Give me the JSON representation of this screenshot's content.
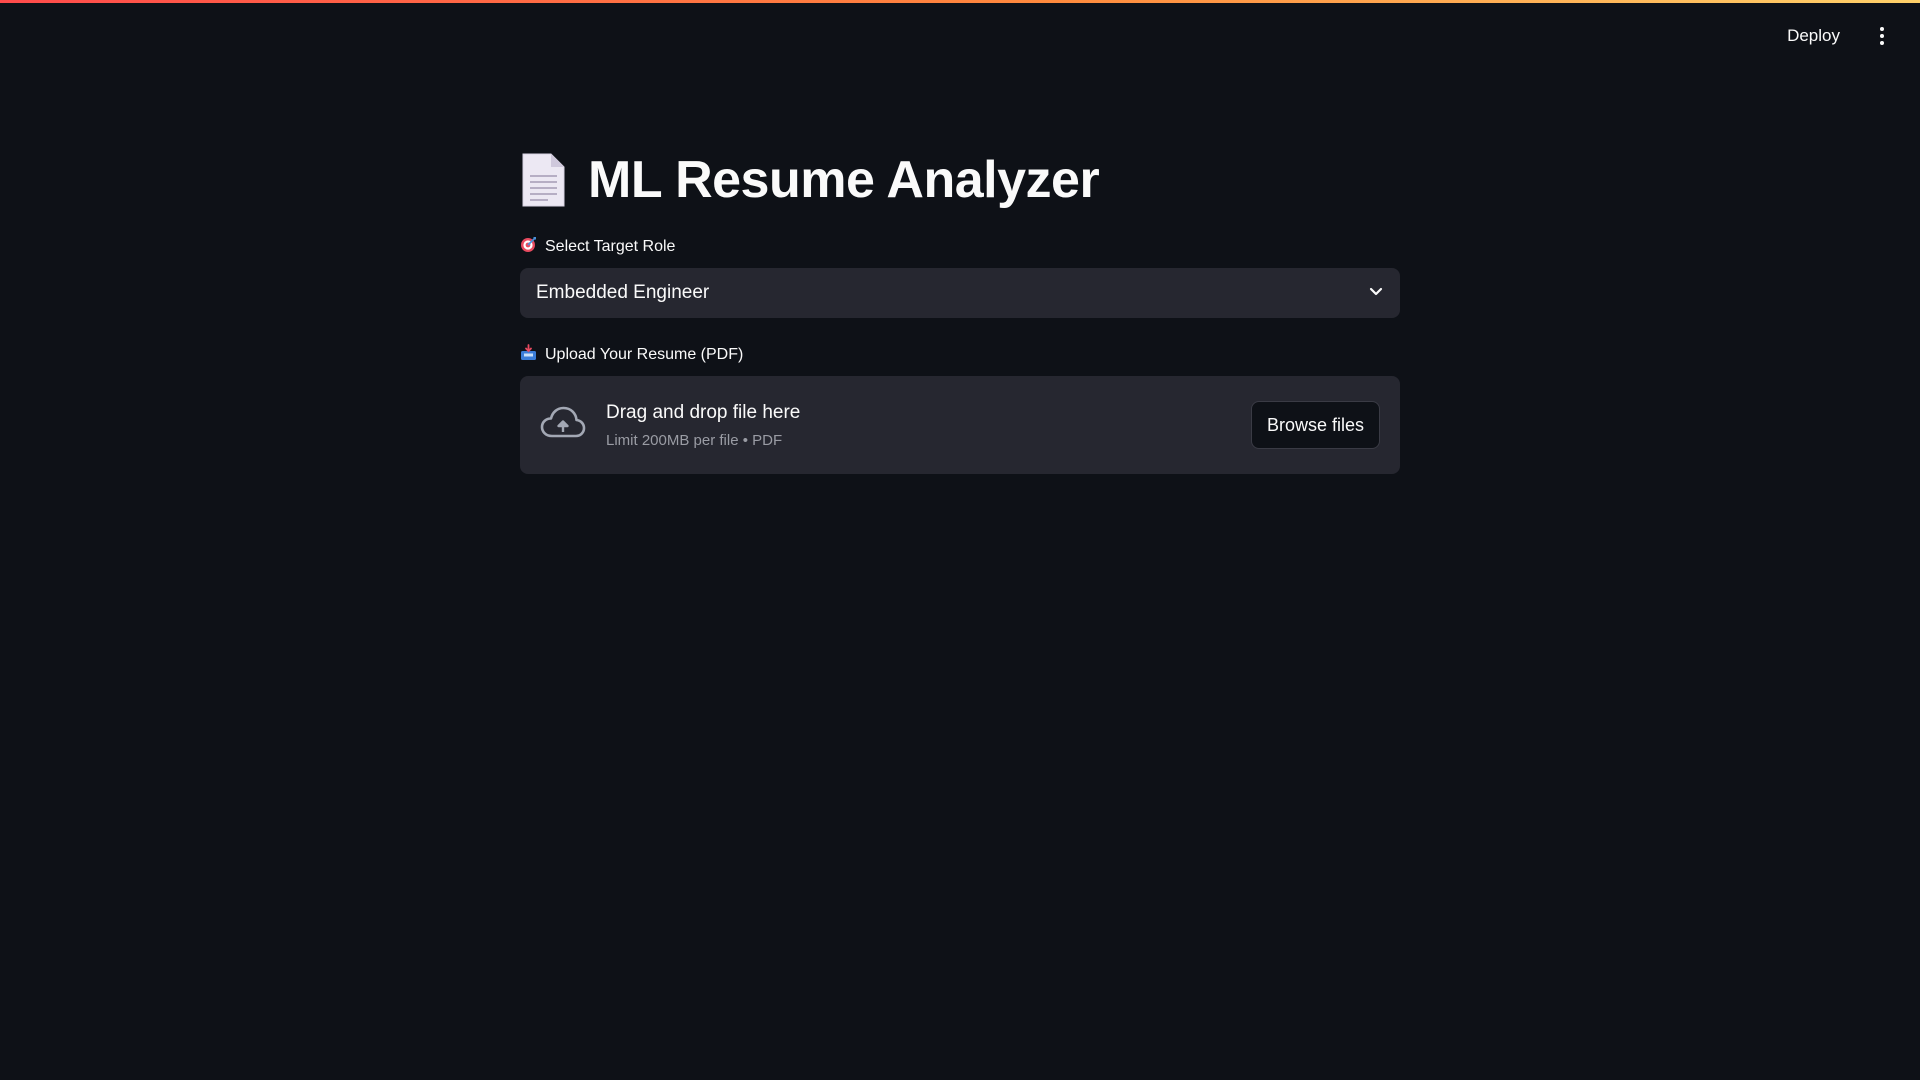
{
  "header": {
    "deploy_label": "Deploy",
    "menu_icon": "vertical-dots-icon"
  },
  "main": {
    "title_icon": "page-document-icon",
    "title": "ML Resume Analyzer",
    "role_select": {
      "icon": "target-dart-icon",
      "label": "Select Target Role",
      "value": "Embedded Engineer",
      "chevron_icon": "chevron-down-icon"
    },
    "uploader": {
      "icon": "inbox-tray-icon",
      "label": "Upload Your Resume (PDF)",
      "cloud_icon": "cloud-upload-icon",
      "drag_text": "Drag and drop file here",
      "limit_text": "Limit 200MB per file • PDF",
      "browse_label": "Browse files"
    }
  },
  "colors": {
    "background": "#0e1117",
    "input_background": "#262730",
    "accent_gradient_start": "#ff4b4b",
    "accent_gradient_end": "#ffd16a"
  }
}
